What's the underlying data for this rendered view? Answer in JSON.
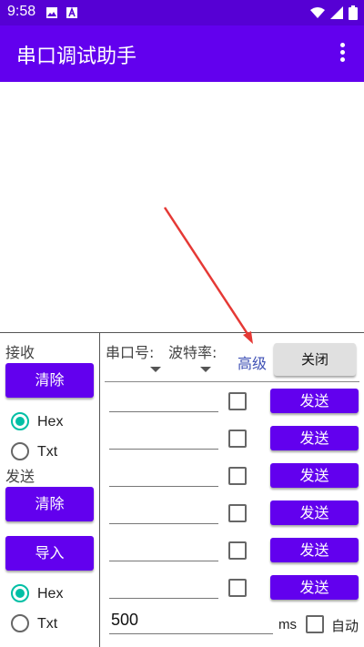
{
  "status_bar": {
    "time": "9:58"
  },
  "app_bar": {
    "title": "串口调试助手"
  },
  "left_panel": {
    "receive_label": "接收",
    "receive_clear_button": "清除",
    "receive_format": {
      "options": [
        "Hex",
        "Txt"
      ],
      "selected": "Hex"
    },
    "send_label": "发送",
    "send_clear_button": "清除",
    "import_button": "导入",
    "send_format": {
      "options": [
        "Hex",
        "Txt"
      ],
      "selected": "Hex"
    }
  },
  "right_panel": {
    "port_label": "串口号:",
    "baud_label": "波特率:",
    "advanced_link": "高级",
    "close_button": "关闭",
    "send_rows": [
      {
        "value": "",
        "checked": false,
        "button": "发送"
      },
      {
        "value": "",
        "checked": false,
        "button": "发送"
      },
      {
        "value": "",
        "checked": false,
        "button": "发送"
      },
      {
        "value": "",
        "checked": false,
        "button": "发送"
      },
      {
        "value": "",
        "checked": false,
        "button": "发送"
      },
      {
        "value": "",
        "checked": false,
        "button": "发送"
      }
    ],
    "interval_value": "500",
    "interval_unit": "ms",
    "auto_checked": false,
    "auto_label": "自动"
  },
  "colors": {
    "primary": "#6200ee",
    "accent": "#00bfa5",
    "arrow": "#e53935"
  },
  "icons": [
    "image-icon",
    "a-text-icon",
    "wifi-icon",
    "battery-icon",
    "overflow-menu-icon",
    "dropdown-caret-icon"
  ]
}
